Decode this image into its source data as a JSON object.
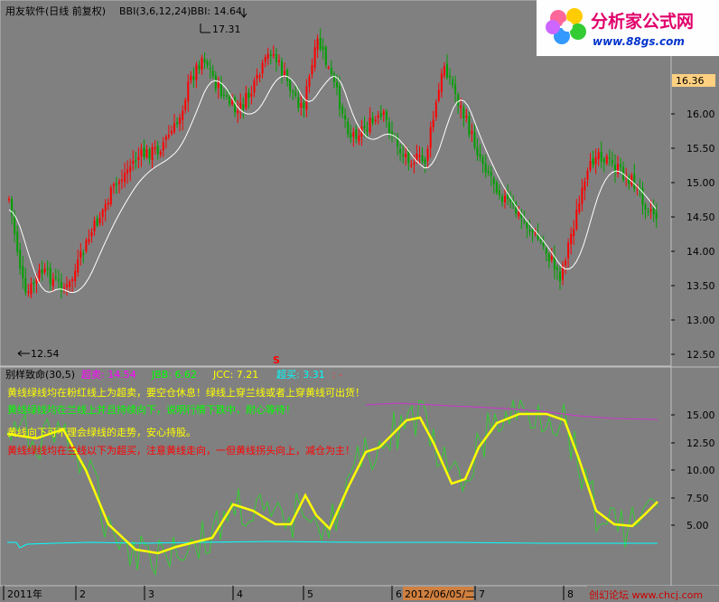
{
  "main_panel": {
    "title": "用友软件(日线 前复权)",
    "indicator_name": "BBI(3,6,12,24)",
    "indicator_value": "BBI: 14.64",
    "marker_high": "17.31",
    "marker_low": "12.54",
    "s_marker": "S",
    "current_price_tag": "16.36",
    "y_axis_labels": [
      "16.00",
      "15.50",
      "15.00",
      "14.50",
      "14.00",
      "13.50",
      "13.00",
      "12.50"
    ]
  },
  "watermark": {
    "brand": "分析家公式网",
    "url": "www.88gs.com"
  },
  "sub_panel": {
    "title": "别样致命(30,5)",
    "legend": [
      {
        "label": "超卖: 14.54",
        "color": "#ff00ff"
      },
      {
        "label": "JBB: 6.62",
        "color": "#00ff00"
      },
      {
        "label": "JCC: 7.21",
        "color": "#ffff00"
      },
      {
        "label": "超买: 3.31",
        "color": "#00ffff"
      }
    ],
    "legend_tail": ": -",
    "notes": [
      {
        "text": "黄线绿线均在粉红线上为超卖，要空仓休息！绿线上穿兰线或者上穿黄线可出货！",
        "color": "#ffff00"
      },
      {
        "text": "黄线绿线均在兰线以下为超买，注意黄线走向，一但黄线拐头向上，减仓为主！",
        "color": "#ff0000"
      },
      {
        "text": "黄线向下可不理会绿线的走势，安心持股。",
        "color": "#ffff00"
      },
      {
        "text": "黄线绿线均在兰线上并且持续向下，说明行情下跌中，耐心等待！",
        "color": "#00ff00"
      }
    ],
    "y_axis_labels": [
      "15.00",
      "12.50",
      "10.00",
      "7.50",
      "5.00"
    ]
  },
  "date_axis": {
    "labels": [
      "2011年",
      "2",
      "3",
      "4",
      "5",
      "6",
      "7",
      "8"
    ],
    "highlight_date": "2012/06/05/二"
  },
  "footer_watermark": "创幻论坛 www.chcj.com",
  "colors": {
    "background": "#808080",
    "up_candle": "#ff0000",
    "down_candle": "#00a000",
    "bbi_line": "#ffffff",
    "yellow_line": "#ffff00",
    "green_line": "#33cc33",
    "pink_line": "#cc33cc",
    "cyan_line": "#00ffff"
  }
}
